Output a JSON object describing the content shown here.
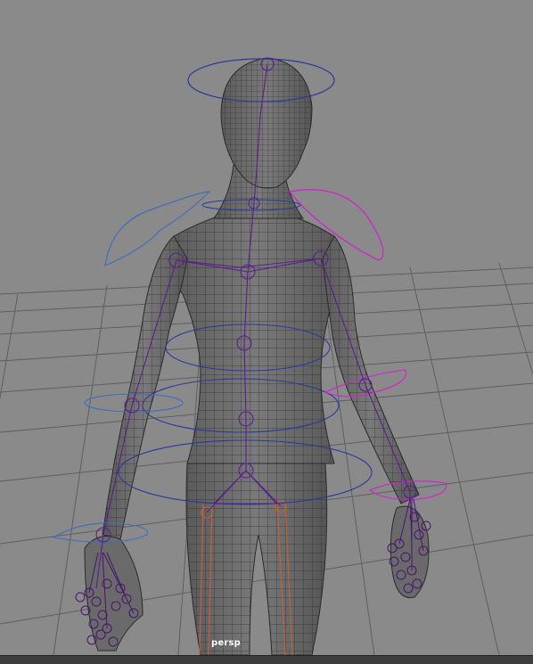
{
  "viewport": {
    "camera_label": "persp",
    "colors": {
      "background": "#8a8a8a",
      "grid": "#5a5a5a",
      "mesh_fill": "#6d6d6d",
      "mesh_wire": "#2a2a2a",
      "joint": "#5a1f8c",
      "control_blue": "#2a3a9a",
      "control_magenta": "#d21fd2",
      "control_light_blue": "#3f6fb8",
      "leg_joint": "#c0603a",
      "bottom_bar": "#3d3d3d"
    },
    "icons": [
      "skeleton-joint-icon",
      "nurbs-control-curve-icon"
    ]
  }
}
